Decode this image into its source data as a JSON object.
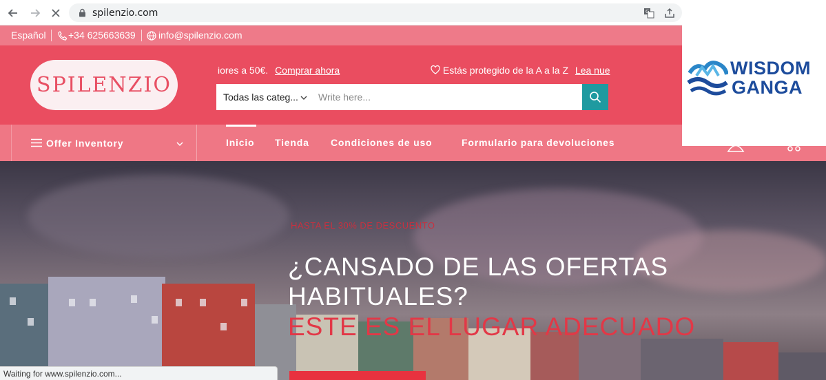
{
  "browser": {
    "url": "spilenzio.com",
    "status_text": "Waiting for www.spilenzio.com..."
  },
  "topbar": {
    "language": "Español",
    "phone": "+34 625663639",
    "email": "info@spilenzio.com"
  },
  "header": {
    "logo_text": "SPILENZIO",
    "promo_text": "iores a 50€.",
    "promo_link": "Comprar ahora",
    "protect_text": "Estás protegido de la A a la Z",
    "protect_link": "Lea nue",
    "search": {
      "category": "Todas las categ...",
      "placeholder": "Write here..."
    }
  },
  "nav": {
    "offer_label": "Offer Inventory",
    "items": [
      "Inicio",
      "Tienda",
      "Condiciones de uso",
      "Formulario para devoluciones"
    ]
  },
  "hero": {
    "subtitle": "HASTA EL 30% DE DESCUENTO",
    "title_line1": "¿CANSADO DE LAS OFERTAS",
    "title_line2": "HABITUALES?",
    "title_line3": "ESTE ES EL LUGAR ADECUADO"
  },
  "watermark": {
    "line1": "WISDOM",
    "line2": "GANGA"
  },
  "colors": {
    "topbar": "#ee7a89",
    "header": "#ea4d60",
    "navbar": "#ef7785",
    "search_button": "#1f9aa0",
    "hero_accent": "#e23847",
    "watermark_text": "#1d4c9c"
  }
}
